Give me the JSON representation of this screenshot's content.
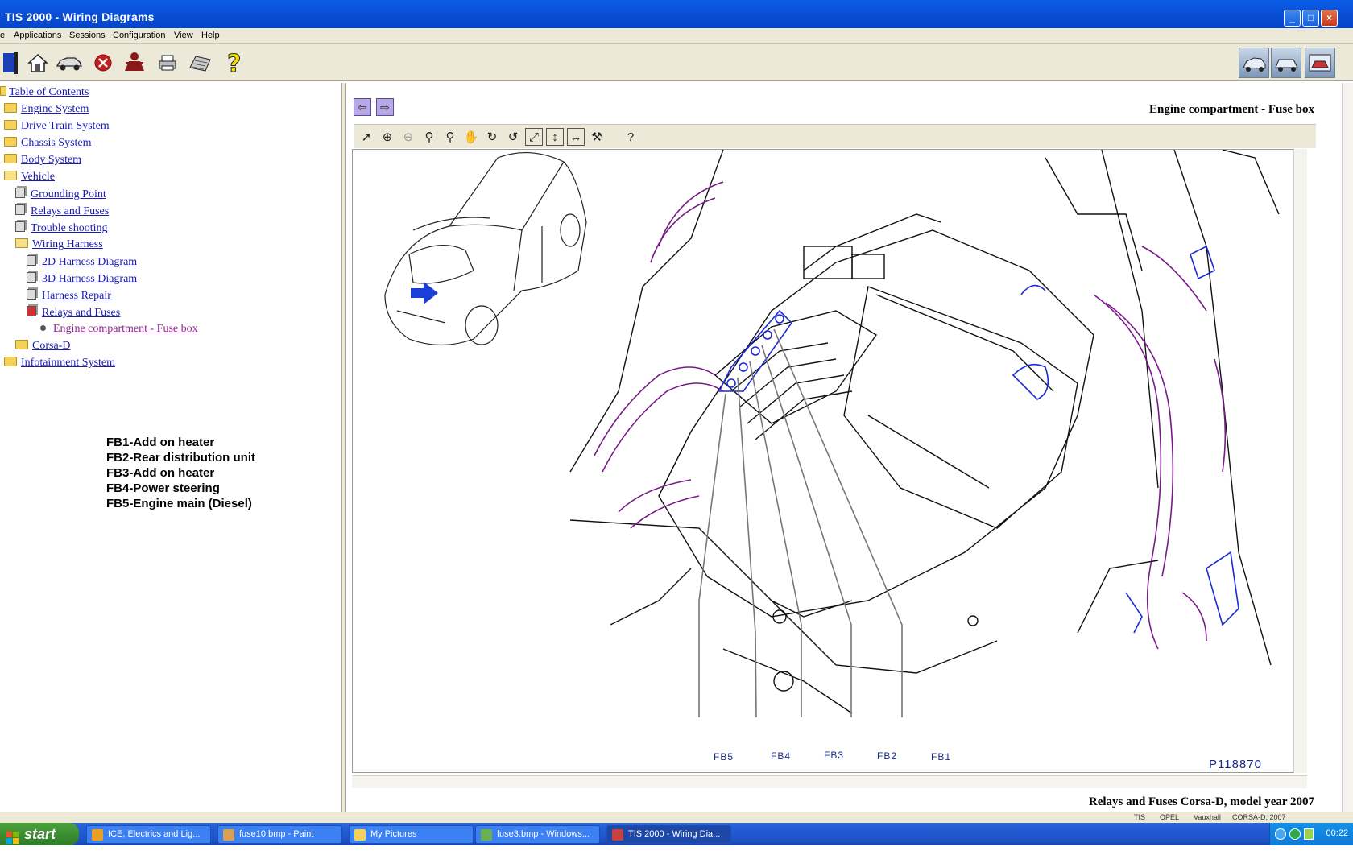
{
  "window": {
    "title": "TIS 2000 - Wiring Diagrams"
  },
  "menu": [
    "e",
    "Applications",
    "Sessions",
    "Configuration",
    "View",
    "Help"
  ],
  "toolbar": {
    "icons": [
      "exit-icon",
      "home-icon",
      "vehicle-icon",
      "stop-icon",
      "person-icon",
      "printer-icon",
      "keyboard-icon",
      "help-icon"
    ],
    "right_icons": [
      "vehicle-select-1-icon",
      "vehicle-select-2-icon",
      "vehicle-select-3-icon"
    ]
  },
  "tree": {
    "items": [
      {
        "label": "Table of Contents",
        "level": 0,
        "icon": "open-folder"
      },
      {
        "label": "Engine System",
        "level": 1,
        "icon": "folder"
      },
      {
        "label": "Drive Train System",
        "level": 1,
        "icon": "folder"
      },
      {
        "label": "Chassis System",
        "level": 1,
        "icon": "folder"
      },
      {
        "label": "Body System",
        "level": 1,
        "icon": "folder"
      },
      {
        "label": "Vehicle",
        "level": 1,
        "icon": "open-folder"
      },
      {
        "label": "Grounding Point",
        "level": 2,
        "icon": "book"
      },
      {
        "label": "Relays and Fuses",
        "level": 2,
        "icon": "book"
      },
      {
        "label": "Trouble shooting",
        "level": 2,
        "icon": "book"
      },
      {
        "label": "Wiring Harness",
        "level": 2,
        "icon": "open-folder"
      },
      {
        "label": "2D Harness Diagram",
        "level": 3,
        "icon": "book"
      },
      {
        "label": "3D Harness Diagram",
        "level": 3,
        "icon": "book"
      },
      {
        "label": "Harness Repair",
        "level": 3,
        "icon": "book"
      },
      {
        "label": "Relays and Fuses",
        "level": 3,
        "icon": "book-red"
      },
      {
        "label": "Engine compartment - Fuse box",
        "level": 4,
        "icon": "bullet"
      },
      {
        "label": "Corsa-D",
        "level": 2,
        "icon": "folder"
      },
      {
        "label": "Infotainment System",
        "level": 1,
        "icon": "folder"
      }
    ]
  },
  "legend": [
    "FB1-Add on heater",
    "FB2-Rear distribution unit",
    "FB3-Add on heater",
    "FB4-Power steering",
    "FB5-Engine main (Diesel)"
  ],
  "document": {
    "title": "Engine compartment - Fuse box",
    "caption": "Relays and Fuses Corsa-D, model year 2007",
    "figure_id": "P118870",
    "callouts": [
      "FB5",
      "FB4",
      "FB3",
      "FB2",
      "FB1"
    ]
  },
  "status": [
    "TIS",
    "OPEL",
    "Vauxhall",
    "CORSA-D, 2007"
  ],
  "taskbar": {
    "start": "start",
    "items": [
      {
        "label": "ICE, Electrics and Lig...",
        "color": "#e8a020"
      },
      {
        "label": "fuse10.bmp - Paint",
        "color": "#d8a050"
      },
      {
        "label": "My Pictures",
        "color": "#f4d25a"
      },
      {
        "label": "fuse3.bmp - Windows...",
        "color": "#6ab04c"
      },
      {
        "label": "TIS 2000 - Wiring Dia...",
        "color": "#c84040"
      }
    ],
    "clock": "00:22"
  }
}
